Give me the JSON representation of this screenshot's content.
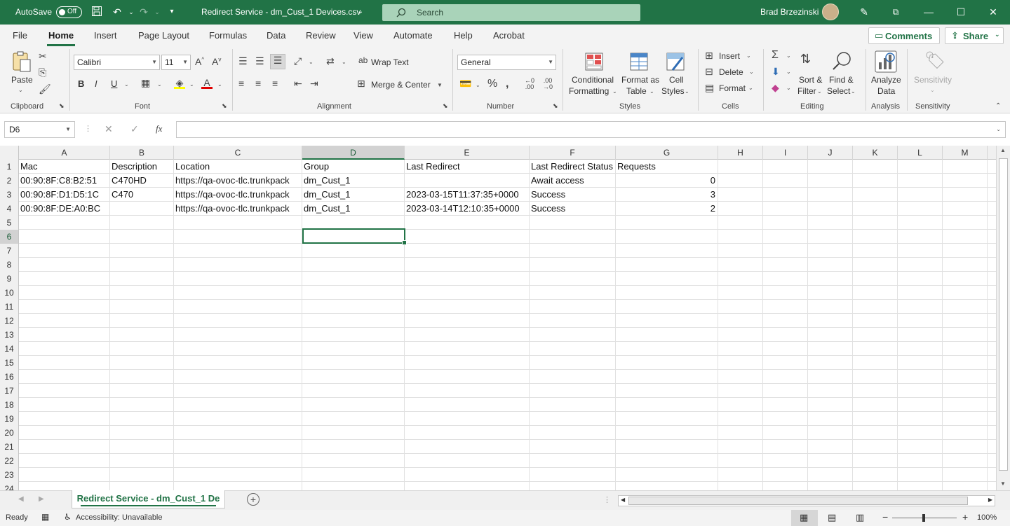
{
  "titlebar": {
    "autosave_label": "AutoSave",
    "autosave_state": "Off",
    "doc_title": "Redirect Service - dm_Cust_1 Devices.csv",
    "search_placeholder": "Search",
    "user_name": "Brad Brzezinski",
    "accent_color": "#217346"
  },
  "menu": {
    "tabs": [
      "File",
      "Home",
      "Insert",
      "Page Layout",
      "Formulas",
      "Data",
      "Review",
      "View",
      "Automate",
      "Help",
      "Acrobat"
    ],
    "active": "Home",
    "comments_label": "Comments",
    "share_label": "Share"
  },
  "ribbon": {
    "clipboard": {
      "paste_label": "Paste",
      "group_label": "Clipboard"
    },
    "font": {
      "font_name": "Calibri",
      "font_size": "11",
      "bold": "B",
      "italic": "I",
      "underline": "U",
      "group_label": "Font"
    },
    "alignment": {
      "wrap_text": "Wrap Text",
      "merge_center": "Merge & Center",
      "group_label": "Alignment"
    },
    "number": {
      "format": "General",
      "group_label": "Number"
    },
    "styles": {
      "conditional": [
        "Conditional",
        "Formatting"
      ],
      "format_table": [
        "Format as",
        "Table"
      ],
      "cell_styles": [
        "Cell",
        "Styles"
      ],
      "group_label": "Styles"
    },
    "cells": {
      "insert": "Insert",
      "delete": "Delete",
      "format": "Format",
      "group_label": "Cells"
    },
    "editing": {
      "sort_filter": [
        "Sort &",
        "Filter"
      ],
      "find_select": [
        "Find &",
        "Select"
      ],
      "group_label": "Editing"
    },
    "analysis": {
      "analyze": [
        "Analyze",
        "Data"
      ],
      "group_label": "Analysis"
    },
    "sensitivity": {
      "label": "Sensitivity",
      "group_label": "Sensitivity"
    }
  },
  "formula_bar": {
    "name_box": "D6",
    "formula": ""
  },
  "sheet": {
    "columns": [
      "A",
      "B",
      "C",
      "D",
      "E",
      "F",
      "G",
      "H",
      "I",
      "J",
      "K",
      "L",
      "M"
    ],
    "selected_column": "D",
    "selected_row": "6",
    "row_numbers": [
      "1",
      "2",
      "3",
      "4",
      "5",
      "6",
      "7",
      "8",
      "9",
      "10",
      "11",
      "12",
      "13",
      "14",
      "15",
      "16",
      "17",
      "18",
      "19",
      "20",
      "21",
      "22",
      "23",
      "24"
    ],
    "rows": [
      [
        "Mac",
        "Description",
        "Location",
        "Group",
        "Last Redirect",
        "Last Redirect Status",
        "Requests"
      ],
      [
        "00:90:8F:C8:B2:51",
        "C470HD",
        "https://qa-ovoc-tlc.trunkpack",
        "dm_Cust_1",
        "",
        "Await access",
        "0"
      ],
      [
        "00:90:8F:D1:D5:1C",
        "C470",
        "https://qa-ovoc-tlc.trunkpack",
        "dm_Cust_1",
        "2023-03-15T11:37:35+0000",
        "Success",
        "3"
      ],
      [
        "00:90:8F:DE:A0:BC",
        "",
        "https://qa-ovoc-tlc.trunkpack",
        "dm_Cust_1",
        "2023-03-14T12:10:35+0000",
        "Success",
        "2"
      ]
    ]
  },
  "sheet_tab": {
    "name": "Redirect Service - dm_Cust_1 De"
  },
  "status": {
    "ready": "Ready",
    "accessibility": "Accessibility: Unavailable",
    "zoom": "100%"
  }
}
